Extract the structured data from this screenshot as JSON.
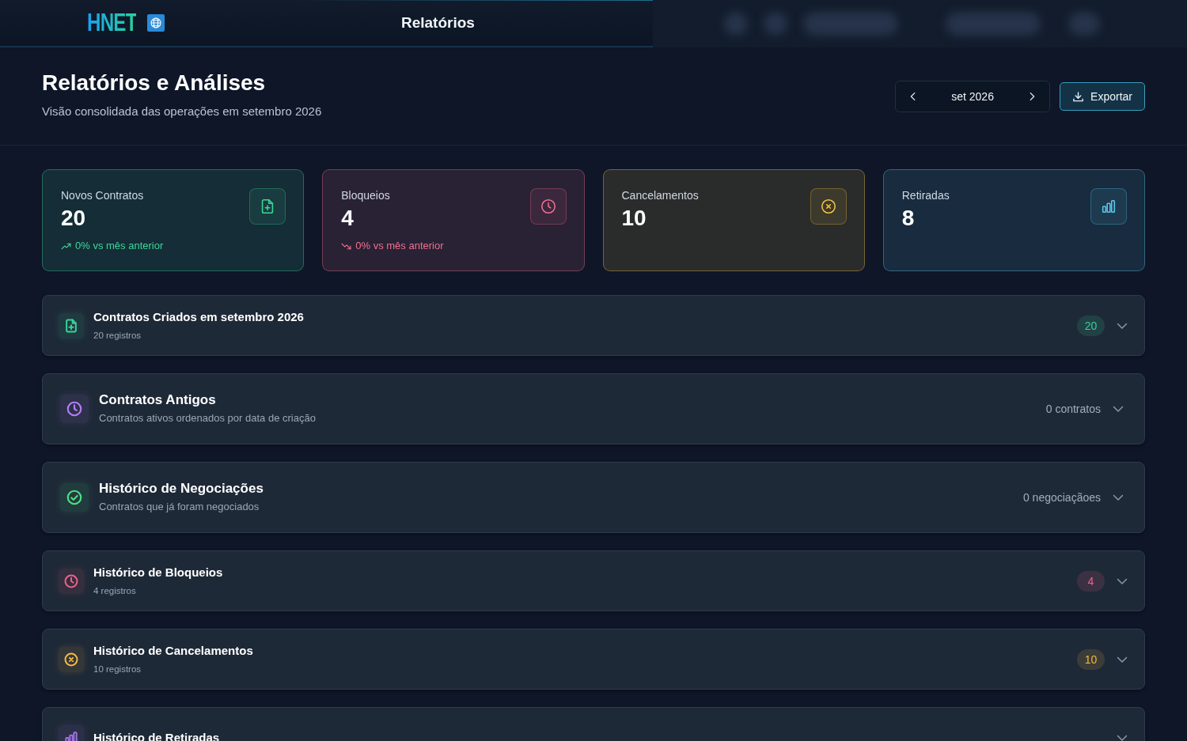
{
  "top_bar": {
    "logo_text": "HNET",
    "title": "Relatórios"
  },
  "header": {
    "title": "Relatórios e Análises",
    "subtitle": "Visão consolidada das operações em setembro 2026",
    "month_picker": {
      "value": "set 2026"
    },
    "export_button": {
      "label": "Exportar"
    }
  },
  "stat_cards": [
    {
      "label": "Novos Contratos",
      "value": "20",
      "color": "#3ed69a",
      "trend": {
        "rising": true,
        "text": "0% vs mês anterior"
      }
    },
    {
      "label": "Bloqueios",
      "value": "4",
      "color": "#f07090",
      "trend": {
        "rising": false,
        "text": "0% vs mês anterior"
      }
    },
    {
      "label": "Cancelamentos",
      "value": "10",
      "color": "#f5c542"
    },
    {
      "label": "Retiradas",
      "value": "8",
      "color": "#5ec8ea"
    }
  ],
  "sections": [
    {
      "kind": "compact",
      "title": "Contratos Criados em setembro 2026",
      "subtitle": "20 registros",
      "badge": "20",
      "color": "#34d399",
      "expanded": false
    },
    {
      "kind": "detailed",
      "title": "Contratos Antigos",
      "subtitle": "Contratos ativos ordenados por data de criação",
      "count": "0 contratos",
      "color": "#b07cf0",
      "expanded": false
    },
    {
      "kind": "detailed",
      "title": "Histórico de Negociações",
      "subtitle": "Contratos que já foram negociados",
      "count": "0 negociaçãoes",
      "color": "#4ade80",
      "expanded": false
    },
    {
      "kind": "compact",
      "title": "Histórico de Bloqueios",
      "subtitle": "4 registros",
      "badge": "4",
      "color": "#f0608a",
      "expanded": false
    },
    {
      "kind": "compact",
      "title": "Histórico de Cancelamentos",
      "subtitle": "10 registros",
      "badge": "10",
      "color": "#f5b942",
      "expanded": false
    },
    {
      "kind": "compact",
      "title": "Histórico de Retiradas",
      "color": "#a070e0",
      "expanded": false
    }
  ]
}
